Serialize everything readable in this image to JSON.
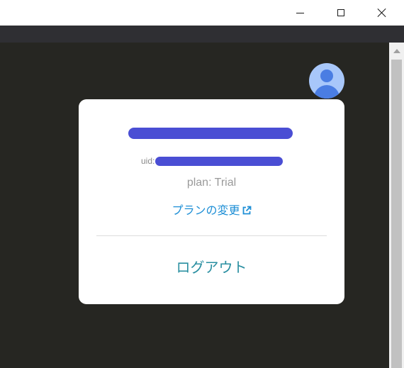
{
  "window": {
    "controls": {
      "minimize_icon": "minimize-icon",
      "maximize_icon": "maximize-icon",
      "close_icon": "close-icon"
    }
  },
  "user_popup": {
    "uid_label": "uid:",
    "plan": "plan: Trial",
    "change_plan_link": "プランの変更",
    "change_plan_icon": "external-link-icon",
    "logout_label": "ログアウト"
  },
  "colors": {
    "app_background": "#262622",
    "link": "#1e8fd6",
    "logout": "#2a8fa1",
    "redaction": "#3b3fd0",
    "avatar": "#a8c7fa"
  }
}
